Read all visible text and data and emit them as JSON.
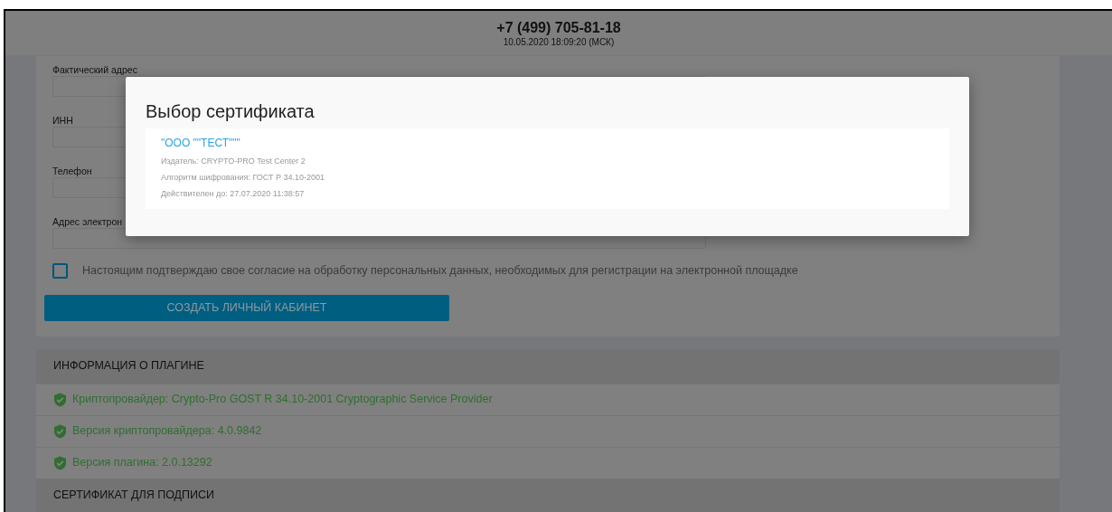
{
  "header": {
    "phone": "+7 (499) 705-81-18",
    "datetime": "10.05.2020 18:09:20 (МСК)"
  },
  "form": {
    "fields": [
      {
        "label": "Фактический адрес"
      },
      {
        "label": "ИНН"
      },
      {
        "label": "Телефон"
      },
      {
        "label": "Адрес электрон"
      }
    ],
    "consent": {
      "text": "Настоящим подтверждаю свое согласие на обработку персональных данных, необходимых для регистрации на электронной площадке",
      "checked": false
    },
    "submit_button": "СОЗДАТЬ ЛИЧНЫЙ КАБИНЕТ"
  },
  "plugin_info": {
    "title": "ИНФОРМАЦИЯ О ПЛАГИНЕ",
    "items": [
      {
        "text": "Криптопровайдер: Crypto-Pro GOST R 34.10-2001 Cryptographic Service Provider"
      },
      {
        "text": "Версия криптопровайдера: 4.0.9842"
      },
      {
        "text": "Версия плагина: 2.0.13292"
      }
    ]
  },
  "signature_section": {
    "title": "СЕРТИФИКАТ ДЛЯ ПОДПИСИ"
  },
  "modal": {
    "title": "Выбор сертификата",
    "certificates": [
      {
        "name": "\"ООО \"\"ТЕСТ\"\"\"",
        "issuer": "Издатель: CRYPTO-PRO Test Center 2",
        "algorithm": "Алгоритм шифрования: ГОСТ Р 34.10-2001",
        "valid_until": "Действителен до: 27.07.2020 11:38:57"
      }
    ]
  }
}
